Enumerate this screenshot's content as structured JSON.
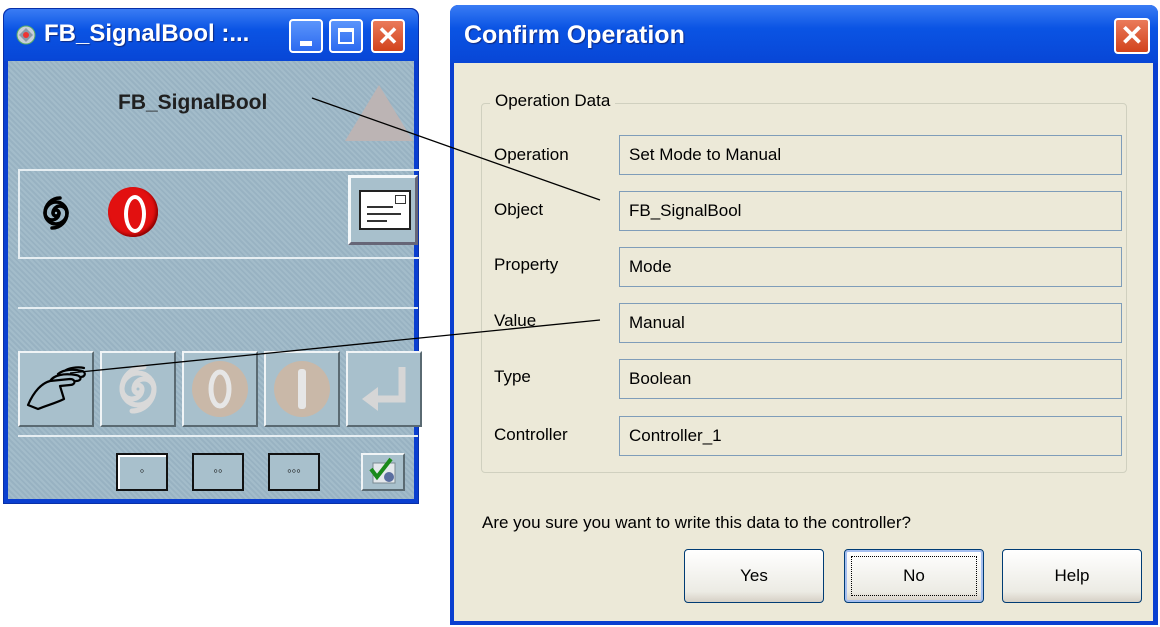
{
  "fb_window": {
    "title": "FB_SignalBool :...",
    "block_name": "FB_SignalBool",
    "level_buttons": [
      "◦",
      "◦◦",
      "◦◦◦"
    ]
  },
  "dialog": {
    "title": "Confirm Operation",
    "close_label": "✕",
    "group_title": "Operation Data",
    "fields": [
      {
        "label": "Operation",
        "value": "Set Mode to Manual"
      },
      {
        "label": "Object",
        "value": "FB_SignalBool"
      },
      {
        "label": "Property",
        "value": "Mode"
      },
      {
        "label": "Value",
        "value": "Manual"
      },
      {
        "label": "Type",
        "value": "Boolean"
      },
      {
        "label": "Controller",
        "value": "Controller_1"
      }
    ],
    "question": "Are you sure you want to write this data to the controller?",
    "buttons": {
      "yes": "Yes",
      "no": "No",
      "help": "Help"
    }
  },
  "icons": {
    "title_icon": "faceplate-icon",
    "status_icons": [
      "swirl-icon",
      "red-stop-icon",
      "message-icon"
    ],
    "tool_icons": [
      "manual-hand-icon",
      "auto-swirl-icon",
      "off-icon",
      "on-icon",
      "enter-icon"
    ],
    "check_icon": "checkmark-icon"
  },
  "colors": {
    "xp_title_blue": "#0a54e4",
    "faceplate_bg": "#9bb6c6",
    "dialog_bg": "#ece9d8",
    "alarm_red": "#e21010"
  }
}
